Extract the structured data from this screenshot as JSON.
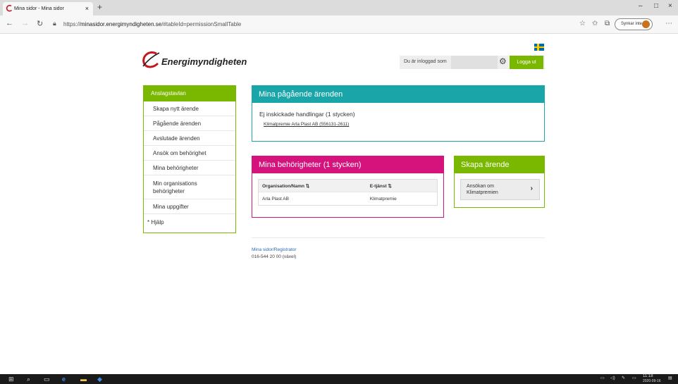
{
  "browser": {
    "tab_title": "Mina sidor - Mina sidor",
    "tab_close": "×",
    "new_tab": "+",
    "url_prefix": "https://",
    "url_domain": "minasidor.energimyndigheten.se",
    "url_path": "/#tableId=permissionSmallTable",
    "sync_label": "Synkar inte",
    "icons": [
      "back-icon",
      "forward-icon",
      "refresh-icon",
      "lock-icon",
      "star-icon",
      "favorites-icon",
      "collections-icon",
      "menu-icon"
    ],
    "window_controls": [
      "–",
      "□",
      "×"
    ]
  },
  "header": {
    "logo_text": "Energimyndigheten",
    "logged_in_label": "Du är inloggad som",
    "logout_label": "Logga ut"
  },
  "sidebar": {
    "heading": "Anslagstavlan",
    "items": [
      {
        "label": "Skapa nytt ärende"
      },
      {
        "label": "Pågående ärenden"
      },
      {
        "label": "Avslutade ärenden"
      },
      {
        "label": "Ansök om behörighet"
      },
      {
        "label": "Mina behörigheter"
      },
      {
        "label": "Min organisations behörigheter"
      },
      {
        "label": "Mina uppgifter"
      },
      {
        "label": "* Hjälp"
      }
    ]
  },
  "ongoing": {
    "title": "Mina pågående ärenden",
    "text": "Ej inskickade handlingar (1 stycken)",
    "link": "Klimatpremie Arla Plast AB (556131-2611)"
  },
  "permissions": {
    "title": "Mina behörigheter (1 stycken)",
    "columns": [
      "Organisation/Namn ⇅",
      "E-tjänst ⇅"
    ],
    "rows": [
      [
        "Arla Plast AB",
        "Klimatpremie"
      ]
    ]
  },
  "create": {
    "title": "Skapa ärende",
    "button_line1": "Ansökan om",
    "button_line2": "Klimatpremien",
    "chevron": "›"
  },
  "footer": {
    "line1": "Mina sidor/Registrator",
    "line2": "016-544 20 00 (växel)"
  },
  "taskbar": {
    "time": "11:18",
    "date": "2020-09-16"
  },
  "colors": {
    "green": "#7ab800",
    "teal": "#1aa5a8",
    "magenta": "#d6137c"
  }
}
